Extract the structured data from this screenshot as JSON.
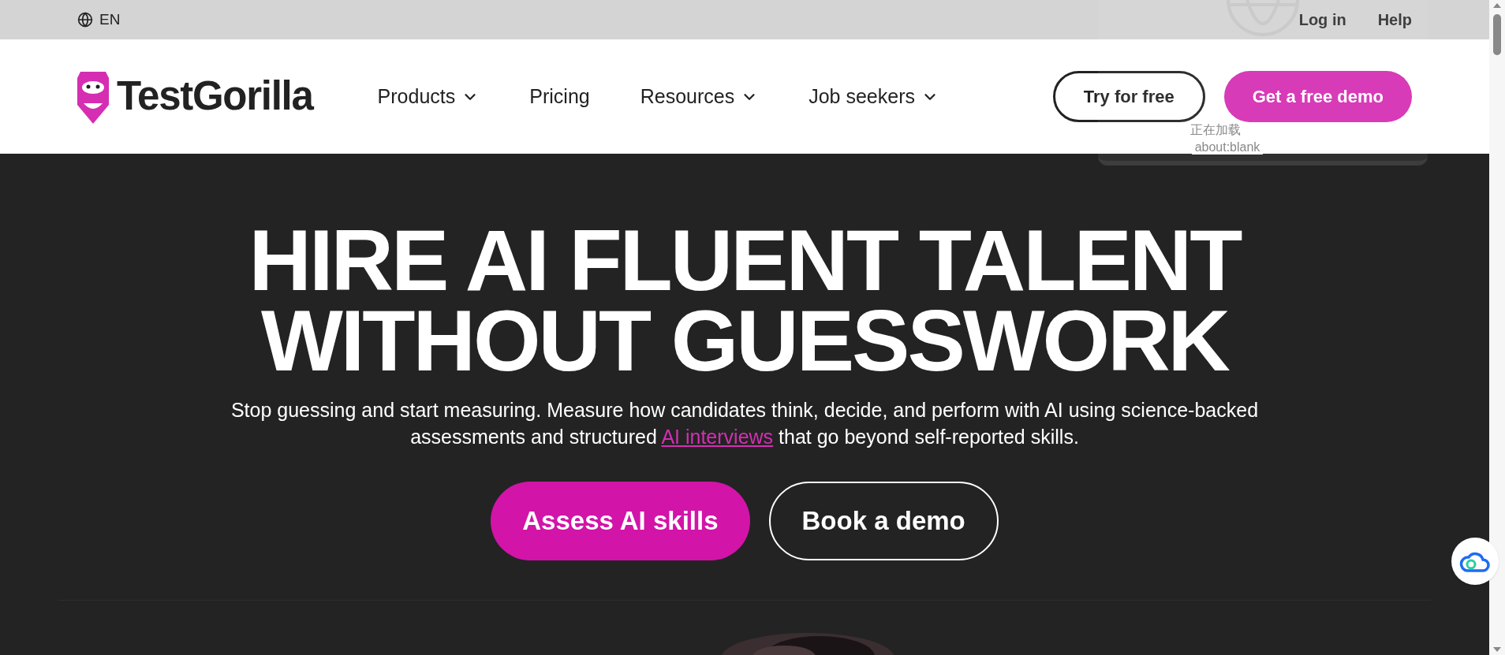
{
  "top_bar": {
    "language": "EN",
    "links": [
      "Log in",
      "Help"
    ]
  },
  "nav": {
    "logo": "TestGorilla",
    "items": [
      {
        "label": "Products",
        "dropdown": true
      },
      {
        "label": "Pricing",
        "dropdown": false
      },
      {
        "label": "Resources",
        "dropdown": true
      },
      {
        "label": "Job seekers",
        "dropdown": true
      }
    ],
    "buttons": [
      {
        "label": "Try for free",
        "kind": "outline"
      },
      {
        "label": "Get a free demo",
        "kind": "filled"
      }
    ]
  },
  "loading_popup": {
    "status": "正在加载",
    "url": "about:blank"
  },
  "hero": {
    "headline": [
      "HIRE AI FLUENT TALENT",
      "WITHOUT GUESSWORK"
    ],
    "subtitle_before": "Stop guessing and start measuring. Measure how candidates think, decide, and perform with AI using science-backed assessments and structured",
    "subtitle_link": "AI interviews",
    "subtitle_after": "that go beyond self-reported skills.",
    "buttons": [
      {
        "label": "Assess AI skills",
        "kind": "filled"
      },
      {
        "label": "Book a demo",
        "kind": "outline"
      }
    ]
  }
}
